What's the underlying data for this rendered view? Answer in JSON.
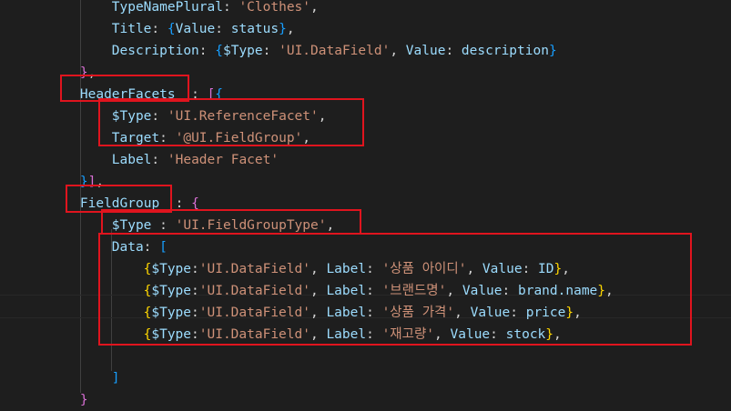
{
  "lines": [
    {
      "indent": 8,
      "tokens": [
        {
          "t": "TypeNamePlural",
          "c": "k"
        },
        {
          "t": ": ",
          "c": "p"
        },
        {
          "t": "'Clothes'",
          "c": "s"
        },
        {
          "t": ",",
          "c": "p"
        }
      ]
    },
    {
      "indent": 8,
      "tokens": [
        {
          "t": "Title",
          "c": "k"
        },
        {
          "t": ": ",
          "c": "p"
        },
        {
          "t": "{",
          "c": "b3"
        },
        {
          "t": "Value",
          "c": "k"
        },
        {
          "t": ": ",
          "c": "p"
        },
        {
          "t": "status",
          "c": "k"
        },
        {
          "t": "}",
          "c": "b3"
        },
        {
          "t": ",",
          "c": "p"
        }
      ]
    },
    {
      "indent": 8,
      "tokens": [
        {
          "t": "Description",
          "c": "k"
        },
        {
          "t": ": ",
          "c": "p"
        },
        {
          "t": "{",
          "c": "b3"
        },
        {
          "t": "$Type",
          "c": "k"
        },
        {
          "t": ": ",
          "c": "p"
        },
        {
          "t": "'UI.DataField'",
          "c": "s"
        },
        {
          "t": ", ",
          "c": "p"
        },
        {
          "t": "Value",
          "c": "k"
        },
        {
          "t": ": ",
          "c": "p"
        },
        {
          "t": "description",
          "c": "k"
        },
        {
          "t": "}",
          "c": "b3"
        }
      ]
    },
    {
      "indent": 4,
      "tokens": [
        {
          "t": "}",
          "c": "b2"
        },
        {
          "t": ",",
          "c": "p"
        }
      ]
    },
    {
      "indent": 4,
      "tokens": [
        {
          "t": "HeaderFacets",
          "c": "k"
        },
        {
          "t": "  : ",
          "c": "p"
        },
        {
          "t": "[",
          "c": "b2"
        },
        {
          "t": "{",
          "c": "b3"
        }
      ]
    },
    {
      "indent": 8,
      "tokens": [
        {
          "t": "$Type",
          "c": "k"
        },
        {
          "t": ": ",
          "c": "p"
        },
        {
          "t": "'UI.ReferenceFacet'",
          "c": "s"
        },
        {
          "t": ",",
          "c": "p"
        }
      ]
    },
    {
      "indent": 8,
      "tokens": [
        {
          "t": "Target",
          "c": "k"
        },
        {
          "t": ": ",
          "c": "p"
        },
        {
          "t": "'@UI.FieldGroup'",
          "c": "s"
        },
        {
          "t": ",",
          "c": "p"
        }
      ]
    },
    {
      "indent": 8,
      "tokens": [
        {
          "t": "Label",
          "c": "k"
        },
        {
          "t": ": ",
          "c": "p"
        },
        {
          "t": "'Header Facet'",
          "c": "s"
        }
      ]
    },
    {
      "indent": 4,
      "tokens": [
        {
          "t": "}",
          "c": "b3"
        },
        {
          "t": "]",
          "c": "b2"
        },
        {
          "t": ",",
          "c": "p"
        }
      ]
    },
    {
      "indent": 4,
      "tokens": [
        {
          "t": "FieldGroup",
          "c": "k"
        },
        {
          "t": "  : ",
          "c": "p"
        },
        {
          "t": "{",
          "c": "b2"
        }
      ]
    },
    {
      "indent": 8,
      "tokens": [
        {
          "t": "$Type",
          "c": "k"
        },
        {
          "t": " : ",
          "c": "p"
        },
        {
          "t": "'UI.FieldGroupType'",
          "c": "s"
        },
        {
          "t": ",",
          "c": "p"
        }
      ]
    },
    {
      "indent": 8,
      "tokens": [
        {
          "t": "Data",
          "c": "k"
        },
        {
          "t": ": ",
          "c": "p"
        },
        {
          "t": "[",
          "c": "b3"
        }
      ]
    },
    {
      "indent": 12,
      "tokens": [
        {
          "t": "{",
          "c": "b1"
        },
        {
          "t": "$Type",
          "c": "k"
        },
        {
          "t": ":",
          "c": "p"
        },
        {
          "t": "'UI.DataField'",
          "c": "s"
        },
        {
          "t": ", ",
          "c": "p"
        },
        {
          "t": "Label",
          "c": "k"
        },
        {
          "t": ": ",
          "c": "p"
        },
        {
          "t": "'상품 아이디'",
          "c": "s"
        },
        {
          "t": ", ",
          "c": "p"
        },
        {
          "t": "Value",
          "c": "k"
        },
        {
          "t": ": ",
          "c": "p"
        },
        {
          "t": "ID",
          "c": "k"
        },
        {
          "t": "}",
          "c": "b1"
        },
        {
          "t": ",",
          "c": "p"
        }
      ]
    },
    {
      "indent": 12,
      "tokens": [
        {
          "t": "{",
          "c": "b1"
        },
        {
          "t": "$Type",
          "c": "k"
        },
        {
          "t": ":",
          "c": "p"
        },
        {
          "t": "'UI.DataField'",
          "c": "s"
        },
        {
          "t": ", ",
          "c": "p"
        },
        {
          "t": "Label",
          "c": "k"
        },
        {
          "t": ": ",
          "c": "p"
        },
        {
          "t": "'브랜드명'",
          "c": "s"
        },
        {
          "t": ", ",
          "c": "p"
        },
        {
          "t": "Value",
          "c": "k"
        },
        {
          "t": ": ",
          "c": "p"
        },
        {
          "t": "brand.name",
          "c": "k"
        },
        {
          "t": "}",
          "c": "b1"
        },
        {
          "t": ",",
          "c": "p"
        }
      ]
    },
    {
      "indent": 12,
      "tokens": [
        {
          "t": "{",
          "c": "b1"
        },
        {
          "t": "$Type",
          "c": "k"
        },
        {
          "t": ":",
          "c": "p"
        },
        {
          "t": "'UI.DataField'",
          "c": "s"
        },
        {
          "t": ", ",
          "c": "p"
        },
        {
          "t": "Label",
          "c": "k"
        },
        {
          "t": ": ",
          "c": "p"
        },
        {
          "t": "'상품 가격'",
          "c": "s"
        },
        {
          "t": ", ",
          "c": "p"
        },
        {
          "t": "Value",
          "c": "k"
        },
        {
          "t": ": ",
          "c": "p"
        },
        {
          "t": "price",
          "c": "k"
        },
        {
          "t": "}",
          "c": "b1"
        },
        {
          "t": ",",
          "c": "p"
        }
      ]
    },
    {
      "indent": 12,
      "tokens": [
        {
          "t": "{",
          "c": "b1"
        },
        {
          "t": "$Type",
          "c": "k"
        },
        {
          "t": ":",
          "c": "p"
        },
        {
          "t": "'UI.DataField'",
          "c": "s"
        },
        {
          "t": ", ",
          "c": "p"
        },
        {
          "t": "Label",
          "c": "k"
        },
        {
          "t": ": ",
          "c": "p"
        },
        {
          "t": "'재고량'",
          "c": "s"
        },
        {
          "t": ", ",
          "c": "p"
        },
        {
          "t": "Value",
          "c": "k"
        },
        {
          "t": ": ",
          "c": "p"
        },
        {
          "t": "stock",
          "c": "k"
        },
        {
          "t": "}",
          "c": "b1"
        },
        {
          "t": ",",
          "c": "p"
        }
      ]
    },
    {
      "indent": 12,
      "tokens": []
    },
    {
      "indent": 8,
      "tokens": [
        {
          "t": "]",
          "c": "b3"
        }
      ]
    },
    {
      "indent": 4,
      "tokens": [
        {
          "t": "}",
          "c": "b2"
        }
      ]
    }
  ],
  "colors": {
    "background": "#1e1e1e",
    "highlight_box": "#e0141e",
    "key": "#9cdcfe",
    "string": "#ce9178",
    "bracket_gold": "#ffd700",
    "bracket_purple": "#da70d6",
    "bracket_blue": "#179fff"
  }
}
